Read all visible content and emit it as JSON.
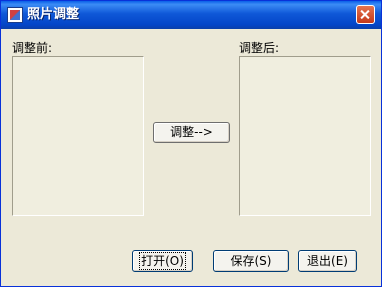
{
  "window": {
    "title": "照片调整"
  },
  "panels": {
    "before_label": "调整前:",
    "after_label": "调整后:"
  },
  "buttons": {
    "adjust": "调整-->",
    "open": "打开(O)",
    "save": "保存(S)",
    "exit": "退出(E)"
  },
  "colors": {
    "titlebar": "#0a5fe8",
    "window_bg": "#ece9d8",
    "close_button": "#d6532c"
  },
  "icons": [
    "app-icon",
    "close-icon"
  ]
}
